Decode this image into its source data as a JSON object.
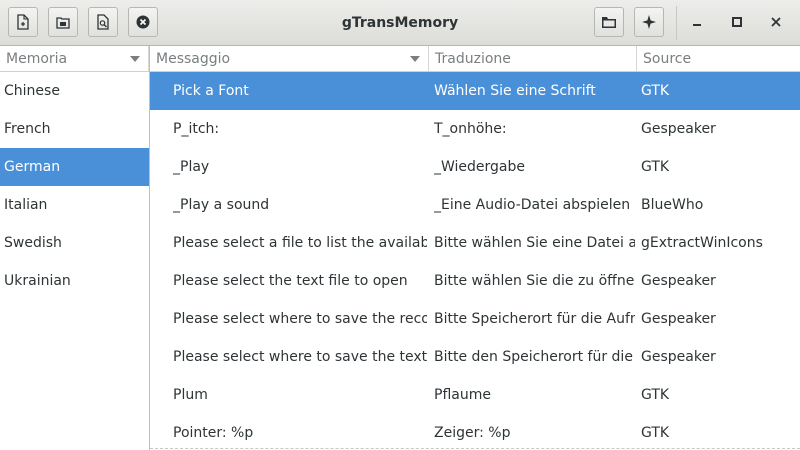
{
  "window": {
    "title": "gTransMemory"
  },
  "toolbar": {
    "left_icons": [
      "new-document-icon",
      "save-icon",
      "preview-icon",
      "stop-icon"
    ],
    "right_icons": [
      "folder-icon",
      "sparkle-icon"
    ],
    "window_controls": [
      "minimize-icon",
      "maximize-icon",
      "close-icon"
    ]
  },
  "memory_pane": {
    "header": "Memoria",
    "items": [
      {
        "label": "Chinese",
        "selected": false
      },
      {
        "label": "French",
        "selected": false
      },
      {
        "label": "German",
        "selected": true
      },
      {
        "label": "Italian",
        "selected": false
      },
      {
        "label": "Swedish",
        "selected": false
      },
      {
        "label": "Ukrainian",
        "selected": false
      }
    ]
  },
  "table": {
    "headers": {
      "message": "Messaggio",
      "translation": "Traduzione",
      "source": "Source"
    },
    "rows": [
      {
        "message": "Pick a Font",
        "translation": "Wählen Sie eine Schrift",
        "source": "GTK",
        "selected": true
      },
      {
        "message": "P_itch:",
        "translation": "T_onhöhe:",
        "source": "Gespeaker"
      },
      {
        "message": "_Play",
        "translation": "_Wiedergabe",
        "source": "GTK"
      },
      {
        "message": "_Play a sound",
        "translation": "_Eine Audio-Datei abspielen",
        "source": "BlueWho"
      },
      {
        "message": "Please select a file to list the available r",
        "translation": "Bitte wählen Sie eine Datei aus,",
        "source": "gExtractWinIcons"
      },
      {
        "message": "Please select the text file to open",
        "translation": "Bitte wählen Sie die zu öffnend",
        "source": "Gespeaker"
      },
      {
        "message": "Please select where to save the recorde",
        "translation": "Bitte Speicherort für die Aufnah",
        "source": "Gespeaker"
      },
      {
        "message": "Please select where to save the text file",
        "translation": "Bitte den Speicherort für die Te",
        "source": "Gespeaker"
      },
      {
        "message": "Plum",
        "translation": "Pflaume",
        "source": "GTK"
      },
      {
        "message": "Pointer: %p",
        "translation": "Zeiger: %p",
        "source": "GTK"
      }
    ]
  },
  "colors": {
    "selection": "#4a90d9",
    "text": "#2e3436",
    "header_text": "#7a7e80"
  }
}
